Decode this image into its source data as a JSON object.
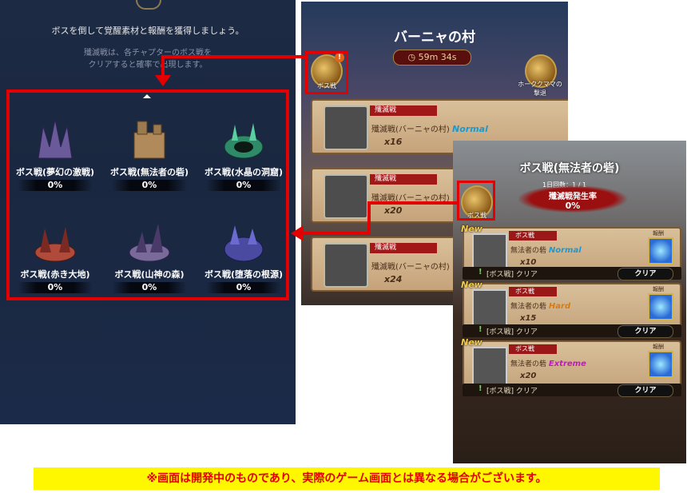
{
  "left_panel": {
    "intro": "ボスを倒して覚醒素材と報酬を獲得しましょう。",
    "note_line1": "殲滅戦は、各チャプターのボス戦を",
    "note_line2": "クリアすると確率で出現します。",
    "bosses": [
      {
        "name": "ボス戦(夢幻の激戦)",
        "percent": "0%",
        "color": "#6a5a9a"
      },
      {
        "name": "ボス戦(無法者の砦)",
        "percent": "0%",
        "color": "#b08a5a"
      },
      {
        "name": "ボス戦(水晶の洞窟)",
        "percent": "0%",
        "color": "#2f8a6a"
      },
      {
        "name": "ボス戦(赤き大地)",
        "percent": "0%",
        "color": "#b04a3a"
      },
      {
        "name": "ボス戦(山神の森)",
        "percent": "0%",
        "color": "#7a6a9a"
      },
      {
        "name": "ボス戦(堕落の根源)",
        "percent": "0%",
        "color": "#4a4aa0"
      }
    ]
  },
  "middle_panel": {
    "title": "バーニャの村",
    "timer": "59m 34s",
    "boss_icon_label": "ボス戦",
    "boss_icon_badge": "!",
    "right_icon_label_line1": "ホーククママの",
    "right_icon_label_line2": "撃退",
    "entries": [
      {
        "tag": "殲滅戦",
        "name": "殲滅戦(バーニャの村)",
        "difficulty": "Normal",
        "multiplier": "x16"
      },
      {
        "tag": "殲滅戦",
        "name": "殲滅戦(バーニャの村)",
        "difficulty": "",
        "multiplier": "x20"
      },
      {
        "tag": "殲滅戦",
        "name": "殲滅戦(バーニャの村)",
        "difficulty": "",
        "multiplier": "x24"
      }
    ]
  },
  "right_panel": {
    "title": "ボス戦(無法者の砦)",
    "daily_count": "1日回数：1 / 1",
    "rate_label": "殲滅戦発生率",
    "rate_value": "0%",
    "boss_icon_label": "ボス戦",
    "cards": [
      {
        "new": "New",
        "tag": "ボス戦",
        "name": "無法者の砦",
        "difficulty": "Normal",
        "difficulty_color": "#1a9ad0",
        "multiplier": "x10",
        "reward_label": "報酬",
        "clear_text": "[ボス戦] クリア",
        "clear_button": "クリア"
      },
      {
        "new": "New",
        "tag": "ボス戦",
        "name": "無法者の砦",
        "difficulty": "Hard",
        "difficulty_color": "#d97a14",
        "multiplier": "x15",
        "reward_label": "報酬",
        "clear_text": "[ボス戦] クリア",
        "clear_button": "クリア"
      },
      {
        "new": "New",
        "tag": "ボス戦",
        "name": "無法者の砦",
        "difficulty": "Extreme",
        "difficulty_color": "#c21ac2",
        "multiplier": "x20",
        "reward_label": "報酬",
        "clear_text": "[ボス戦] クリア",
        "clear_button": "クリア"
      }
    ]
  },
  "disclaimer": "※画面は開発中のものであり、実際のゲーム画面とは異なる場合がございます。",
  "colors": {
    "highlight_red": "#e40000",
    "disclaimer_bg": "#fff700"
  }
}
